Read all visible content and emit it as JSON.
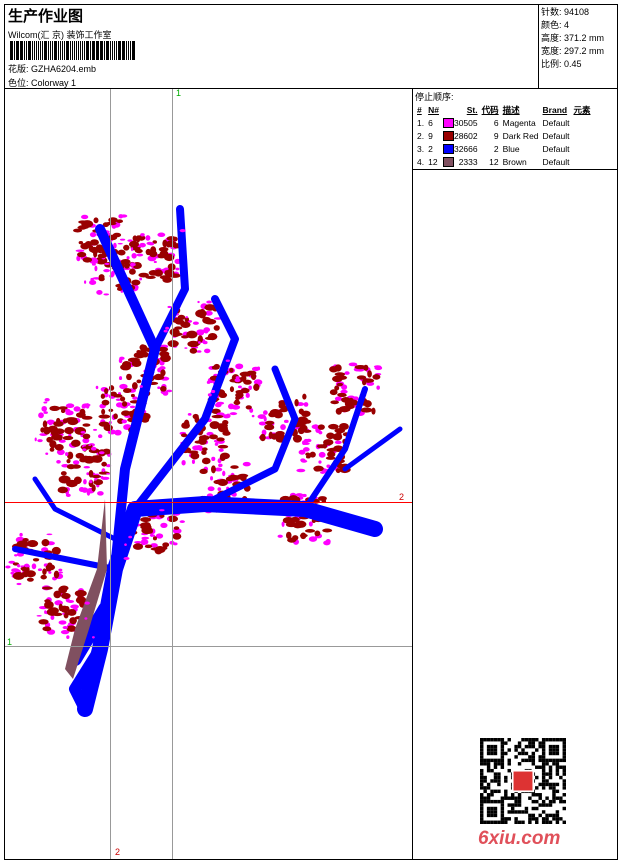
{
  "header": {
    "title": "生产作业图",
    "company": "Wilcom(汇 京) 装饰工作室",
    "design_label": "花版:",
    "design_value": "GZHA6204.emb",
    "colorway_label": "色位:",
    "colorway_value": "Colorway 1"
  },
  "stats": [
    {
      "label": "针数:",
      "value": "94108"
    },
    {
      "label": "颜色:",
      "value": "4"
    },
    {
      "label": "高度:",
      "value": "371.2 mm"
    },
    {
      "label": "宽度:",
      "value": "297.2 mm"
    },
    {
      "label": "比例:",
      "value": "0.45"
    }
  ],
  "stop_sequence": {
    "title": "停止顺序:",
    "columns": [
      "#",
      "N#",
      "St.",
      "代码",
      "描述",
      "Brand",
      "元素"
    ],
    "rows": [
      {
        "idx": "1.",
        "n": "6",
        "color": "#ff00ff",
        "st": "30505",
        "code": "6",
        "desc": "Magenta",
        "brand": "Default"
      },
      {
        "idx": "2.",
        "n": "9",
        "color": "#990000",
        "st": "28602",
        "code": "9",
        "desc": "Dark Red",
        "brand": "Default"
      },
      {
        "idx": "3.",
        "n": "2",
        "color": "#0000ff",
        "st": "32666",
        "code": "2",
        "desc": "Blue",
        "brand": "Default"
      },
      {
        "idx": "4.",
        "n": "12",
        "color": "#805060",
        "st": "2333",
        "code": "12",
        "desc": "Brown",
        "brand": "Default"
      }
    ]
  },
  "guides": {
    "v1": "1",
    "v2": "2",
    "h1": "1",
    "h2": "2"
  },
  "watermark": "6xiu.com"
}
